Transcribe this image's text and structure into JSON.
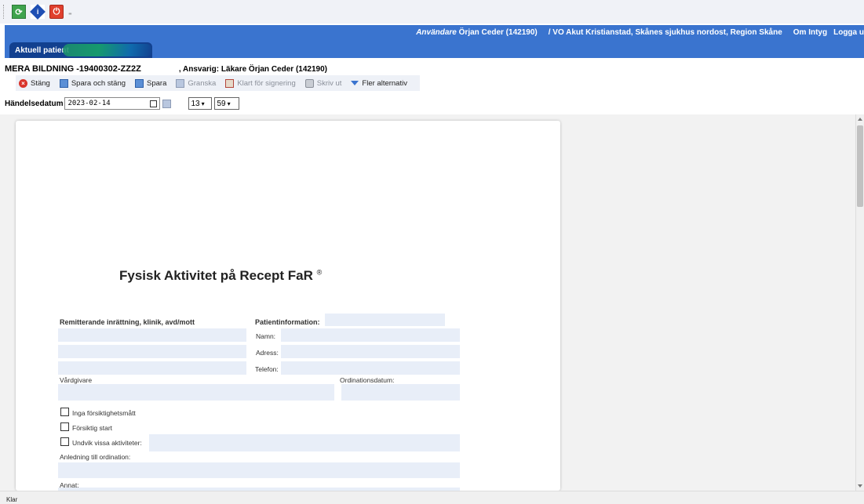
{
  "toolbar": {
    "icons": [
      "refresh-icon",
      "info-icon",
      "power-icon"
    ],
    "refresh_glyph": "⟳",
    "info_glyph": "i",
    "power_glyph": "⏻",
    "more_glyph": "⁼"
  },
  "header": {
    "user_label": "Användare",
    "user_name": "Örjan Ceder (142190)",
    "unit": "/ VO Akut Kristianstad, Skånes sjukhus nordost, Region Skåne",
    "about": "Om Intyg",
    "logout": "Logga u",
    "patient_tab": "Aktuell patient"
  },
  "patient": {
    "name_id": "MERA BILDNING -19400302-ZZ2Z",
    "responsible": ", Ansvarig: Läkare Örjan Ceder (142190)"
  },
  "actions": {
    "close": "Stäng",
    "save_close": "Spara och stäng",
    "save": "Spara",
    "review": "Granska",
    "ready_sign": "Klart för signering",
    "print": "Skriv ut",
    "more": "Fler alternativ"
  },
  "event_date": {
    "label": "Händelsedatum",
    "value": "2023-02-14",
    "hour": "13",
    "minute": "59"
  },
  "document": {
    "title": "Fysisk Aktivitet på Recept FaR",
    "title_mark": "®",
    "referring_unit": "Remitterande inrättning, klinik, avd/mott",
    "patient_info": "Patientinformation:",
    "name": "Namn:",
    "address": "Adress:",
    "phone": "Telefon:",
    "caregiver": "Vårdgivare",
    "order_date": "Ordinationsdatum:",
    "no_precautions": "Inga försiktighetsmått",
    "careful_start": "Försiktig start",
    "avoid_activities": "Undvik vissa aktiviteter:",
    "reason": "Anledning till ordination:",
    "other": "Annat:"
  },
  "status": {
    "text": "Klar"
  },
  "colors": {
    "header_blue": "#3a74cf",
    "tab_blue": "#12408f",
    "field_bg": "#e8eef8"
  }
}
